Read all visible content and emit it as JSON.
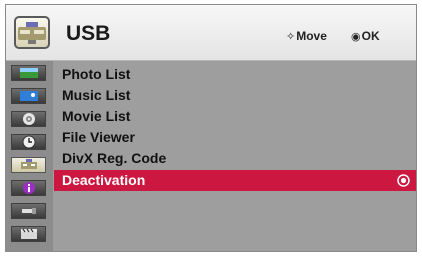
{
  "header": {
    "title": "USB",
    "icon": "usb-folder-icon",
    "hint_move": "Move",
    "hint_ok": "OK"
  },
  "side_icons": [
    {
      "name": "picture-icon"
    },
    {
      "name": "photo-icon"
    },
    {
      "name": "disc-icon"
    },
    {
      "name": "clock-icon"
    },
    {
      "name": "usb-icon",
      "active": true
    },
    {
      "name": "info-icon"
    },
    {
      "name": "input-icon"
    },
    {
      "name": "clapper-icon"
    }
  ],
  "menu": {
    "items": [
      {
        "label": "Photo List"
      },
      {
        "label": "Music List"
      },
      {
        "label": "Movie List"
      },
      {
        "label": "File Viewer"
      },
      {
        "label": "DivX Reg. Code"
      },
      {
        "label": "Deactivation",
        "selected": true
      }
    ],
    "selected_color": "#cc1840"
  }
}
